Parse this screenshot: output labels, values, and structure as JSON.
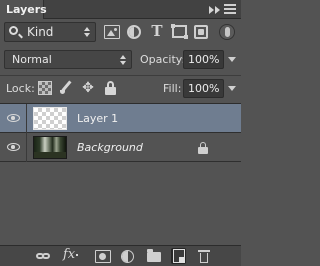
{
  "panel": {
    "tab_label": "Layers",
    "collapse_icon": "double-chevron-right-icon",
    "menu_icon": "hamburger-menu-icon"
  },
  "filter": {
    "kind_label": "Kind",
    "kind_icon": "search-icon",
    "filter_icons": [
      "image-filter-icon",
      "adjustment-filter-icon",
      "type-filter-icon",
      "shape-filter-icon",
      "smart-object-filter-icon"
    ],
    "type_glyph": "T",
    "toggle_icon": "filter-toggle-icon"
  },
  "blend": {
    "mode": "Normal",
    "opacity_label": "Opacity:",
    "opacity_value": "100%"
  },
  "lock": {
    "label": "Lock:",
    "icons": [
      "lock-transparent-pixels-icon",
      "lock-image-pixels-icon",
      "lock-position-icon",
      "lock-all-icon"
    ],
    "move_glyph": "✥",
    "fill_label": "Fill:",
    "fill_value": "100%"
  },
  "layers": [
    {
      "name": "Layer 1",
      "selected": true,
      "visible": true,
      "thumbnail": "transparent",
      "locked": false
    },
    {
      "name": "Background",
      "selected": false,
      "visible": true,
      "thumbnail": "forest-photo",
      "locked": true
    }
  ],
  "toolbar": {
    "icons": [
      "link-layers-icon",
      "fx-icon",
      "layer-mask-icon",
      "adjustment-layer-icon",
      "new-group-folder-icon",
      "new-layer-icon",
      "trash-icon"
    ],
    "fx_label": "fx"
  },
  "colors": {
    "panel_bg": "#535353",
    "selected_row": "#6f7d90",
    "tab_strip": "#424242"
  }
}
